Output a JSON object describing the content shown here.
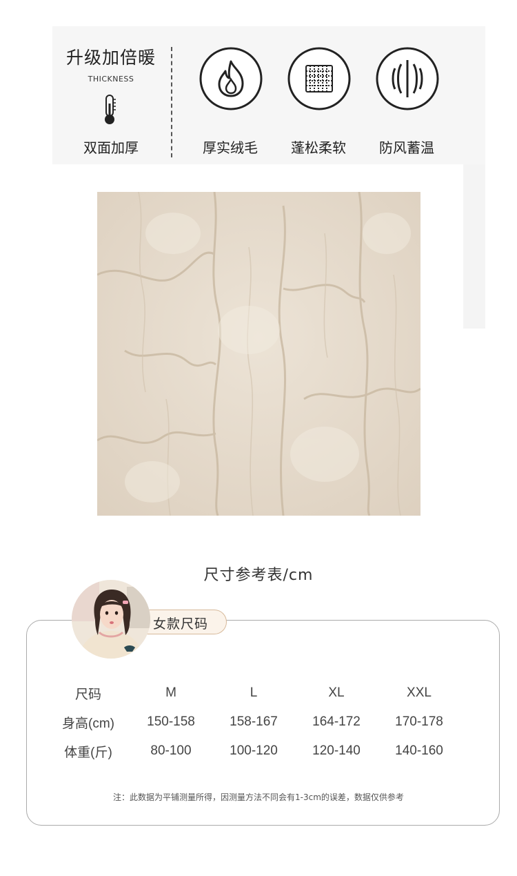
{
  "banner": {
    "heading": "升级加倍暖",
    "subheading": "THICKNESS",
    "thickness_label": "双面加厚",
    "features": [
      {
        "icon": "flame-icon",
        "label": "厚实绒毛"
      },
      {
        "icon": "woven-fabric-icon",
        "label": "蓬松柔软"
      },
      {
        "icon": "windproof-icon",
        "label": "防风蓄温"
      }
    ]
  },
  "size_chart": {
    "title": "尺寸参考表/cm",
    "tag": "女款尺码",
    "header": [
      "尺码",
      "M",
      "L",
      "XL",
      "XXL"
    ],
    "rows": [
      [
        "身高(cm)",
        "150-158",
        "158-167",
        "164-172",
        "170-178"
      ],
      [
        "体重(斤)",
        "80-100",
        "100-120",
        "120-140",
        "140-160"
      ]
    ],
    "note": "注：此数据为平铺测量所得，因测量方法不同会有1-3cm的误差，数据仅供参考"
  },
  "colors": {
    "fabric": "#e6dbcc",
    "tag_border": "#d7b99a",
    "tag_fill": "#fbf3ea"
  }
}
